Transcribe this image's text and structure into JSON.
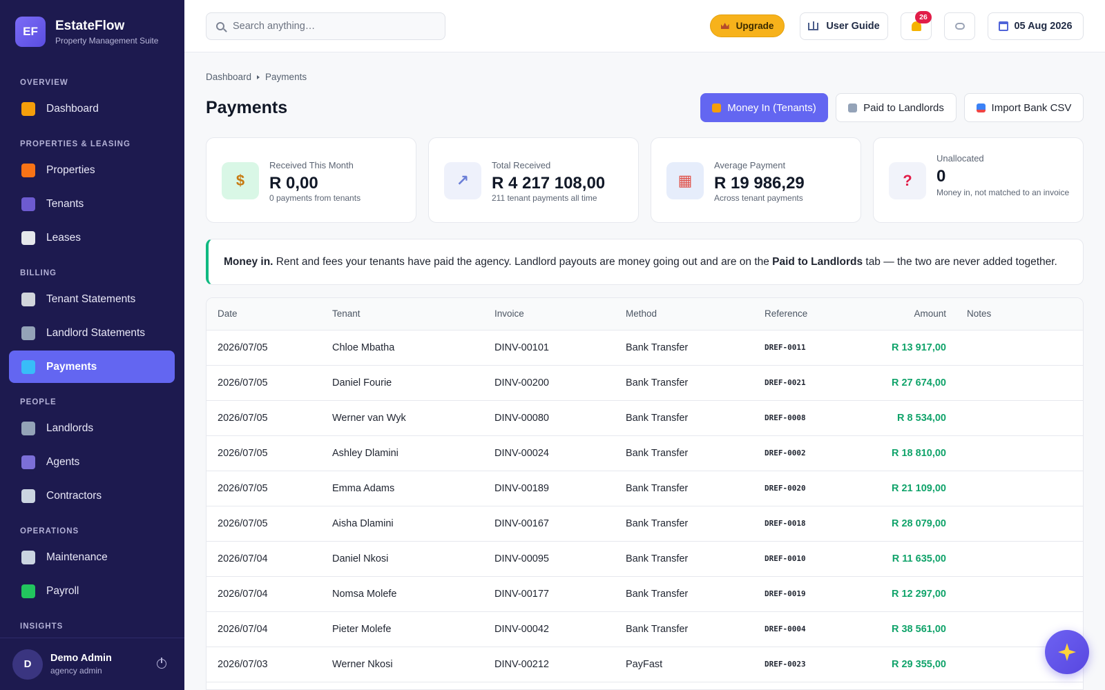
{
  "brand": {
    "logo": "EF",
    "name": "EstateFlow",
    "subtitle": "Property Management Suite"
  },
  "sidebar": {
    "sections": [
      {
        "label": "OVERVIEW",
        "items": [
          {
            "label": "Dashboard",
            "icon": "bar-chart-icon",
            "color": "#f59e0b"
          }
        ]
      },
      {
        "label": "PROPERTIES & LEASING",
        "items": [
          {
            "label": "Properties",
            "icon": "house-icon",
            "color": "#f97316"
          },
          {
            "label": "Tenants",
            "icon": "users-icon",
            "color": "#6d5bd0"
          },
          {
            "label": "Leases",
            "icon": "document-icon",
            "color": "#e5e7eb"
          }
        ]
      },
      {
        "label": "BILLING",
        "items": [
          {
            "label": "Tenant Statements",
            "icon": "receipt-icon",
            "color": "#d1d5db"
          },
          {
            "label": "Landlord Statements",
            "icon": "building-icon",
            "color": "#94a3b8"
          },
          {
            "label": "Payments",
            "icon": "credit-card-icon",
            "color": "#38bdf8",
            "active": true
          }
        ]
      },
      {
        "label": "PEOPLE",
        "items": [
          {
            "label": "Landlords",
            "icon": "building-icon",
            "color": "#94a3b8"
          },
          {
            "label": "Agents",
            "icon": "person-icon",
            "color": "#7c6fd8"
          },
          {
            "label": "Contractors",
            "icon": "tools-icon",
            "color": "#cbd5e1"
          }
        ]
      },
      {
        "label": "OPERATIONS",
        "items": [
          {
            "label": "Maintenance",
            "icon": "wrench-icon",
            "color": "#cbd5e1"
          },
          {
            "label": "Payroll",
            "icon": "cash-icon",
            "color": "#22c55e"
          }
        ]
      },
      {
        "label": "INSIGHTS",
        "items": []
      }
    ]
  },
  "user": {
    "initial": "D",
    "name": "Demo Admin",
    "role": "agency admin"
  },
  "topbar": {
    "search_placeholder": "Search anything…",
    "upgrade_label": "Upgrade",
    "guide_label": "User Guide",
    "notification_count": "26",
    "date_label": "05 Aug 2026"
  },
  "breadcrumb": {
    "root": "Dashboard",
    "current": "Payments"
  },
  "page": {
    "title": "Payments"
  },
  "tabs": {
    "money_in": "Money In (Tenants)",
    "paid_out": "Paid to Landlords",
    "import": "Import Bank CSV"
  },
  "cards": [
    {
      "label": "Received This Month",
      "value": "R 0,00",
      "sub": "0 payments from tenants",
      "icon": "money-bag-icon",
      "bg": "#d9f7e6"
    },
    {
      "label": "Total Received",
      "value": "R 4 217 108,00",
      "sub": "211 tenant payments all time",
      "icon": "trend-up-icon",
      "bg": "#eef1fb"
    },
    {
      "label": "Average Payment",
      "value": "R 19 986,29",
      "sub": "Across tenant payments",
      "icon": "abacus-icon",
      "bg": "#e6edfb"
    },
    {
      "label": "Unallocated",
      "value": "0",
      "sub": "Money in, not matched to an invoice",
      "icon": "question-icon",
      "bg": "#f1f3fa"
    }
  ],
  "notice": {
    "lead": "Money in.",
    "text_a": " Rent and fees your tenants have paid the agency. Landlord payouts are money going out and are on the ",
    "tab_ref": "Paid to Landlords",
    "text_b": " tab — the two are never added together."
  },
  "table": {
    "columns": {
      "date": "Date",
      "tenant": "Tenant",
      "invoice": "Invoice",
      "method": "Method",
      "reference": "Reference",
      "amount": "Amount",
      "notes": "Notes"
    },
    "rows": [
      {
        "date": "2026/07/05",
        "tenant": "Chloe Mbatha",
        "invoice": "DINV-00101",
        "method": "Bank Transfer",
        "reference": "DREF-0011",
        "amount": "R 13 917,00",
        "notes": ""
      },
      {
        "date": "2026/07/05",
        "tenant": "Daniel Fourie",
        "invoice": "DINV-00200",
        "method": "Bank Transfer",
        "reference": "DREF-0021",
        "amount": "R 27 674,00",
        "notes": ""
      },
      {
        "date": "2026/07/05",
        "tenant": "Werner van Wyk",
        "invoice": "DINV-00080",
        "method": "Bank Transfer",
        "reference": "DREF-0008",
        "amount": "R 8 534,00",
        "notes": ""
      },
      {
        "date": "2026/07/05",
        "tenant": "Ashley Dlamini",
        "invoice": "DINV-00024",
        "method": "Bank Transfer",
        "reference": "DREF-0002",
        "amount": "R 18 810,00",
        "notes": ""
      },
      {
        "date": "2026/07/05",
        "tenant": "Emma Adams",
        "invoice": "DINV-00189",
        "method": "Bank Transfer",
        "reference": "DREF-0020",
        "amount": "R 21 109,00",
        "notes": ""
      },
      {
        "date": "2026/07/05",
        "tenant": "Aisha Dlamini",
        "invoice": "DINV-00167",
        "method": "Bank Transfer",
        "reference": "DREF-0018",
        "amount": "R 28 079,00",
        "notes": ""
      },
      {
        "date": "2026/07/04",
        "tenant": "Daniel Nkosi",
        "invoice": "DINV-00095",
        "method": "Bank Transfer",
        "reference": "DREF-0010",
        "amount": "R 11 635,00",
        "notes": ""
      },
      {
        "date": "2026/07/04",
        "tenant": "Nomsa Molefe",
        "invoice": "DINV-00177",
        "method": "Bank Transfer",
        "reference": "DREF-0019",
        "amount": "R 12 297,00",
        "notes": ""
      },
      {
        "date": "2026/07/04",
        "tenant": "Pieter Molefe",
        "invoice": "DINV-00042",
        "method": "Bank Transfer",
        "reference": "DREF-0004",
        "amount": "R 38 561,00",
        "notes": ""
      },
      {
        "date": "2026/07/03",
        "tenant": "Werner Nkosi",
        "invoice": "DINV-00212",
        "method": "PayFast",
        "reference": "DREF-0023",
        "amount": "R 29 355,00",
        "notes": ""
      }
    ]
  },
  "colors": {
    "sidebar_bg": "#1d1a4f",
    "accent": "#6366f1",
    "success": "#10a36a",
    "upgrade": "#f7b21b"
  }
}
